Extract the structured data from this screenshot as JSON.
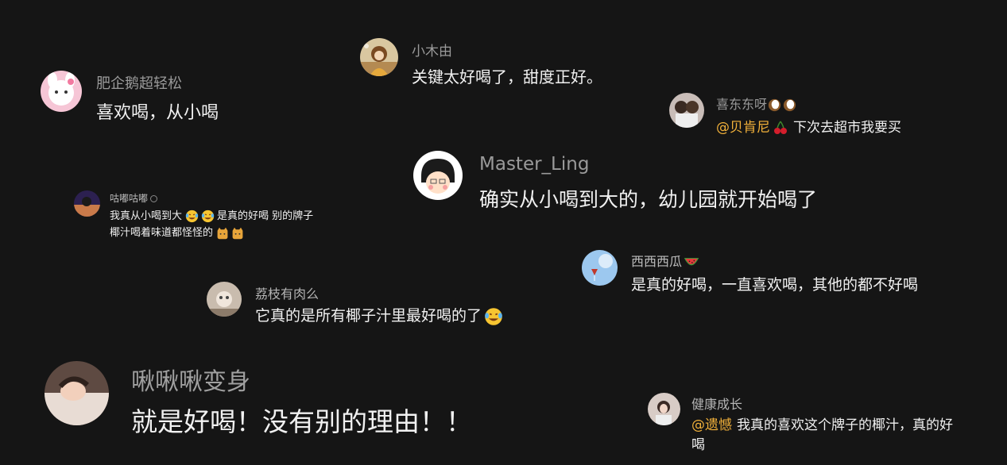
{
  "comments": [
    {
      "id": "xiaomuyou",
      "username": "小木由",
      "text": "关键太好喝了，甜度正好。"
    },
    {
      "id": "feiqie",
      "username": "肥企鹅超轻松",
      "text": "喜欢喝，从小喝"
    },
    {
      "id": "xidong",
      "username": "喜东东呀",
      "username_emojis": [
        "coconut",
        "coconut"
      ],
      "mention": "@贝肯尼",
      "mention_emoji": "cherries",
      "text": "下次去超市我要买"
    },
    {
      "id": "masterling",
      "username": "Master_Ling",
      "text": "确实从小喝到大的，幼儿园就开始喝了"
    },
    {
      "id": "gudu",
      "username": "咕嘟咕嘟",
      "badge": "verified-badge",
      "text_line1_a": "我真从小喝到大",
      "text_line1_emojis": [
        "laughing-tears",
        "laughing-tears"
      ],
      "text_line1_b": "是真的好喝 别的牌子",
      "text_line2": "椰汁喝着味道都怪怪的",
      "text_line2_emojis": [
        "cat-face",
        "cat-face"
      ]
    },
    {
      "id": "xigua",
      "username": "西西西瓜",
      "username_emoji": "watermelon",
      "text": "是真的好喝，一直喜欢喝，其他的都不好喝"
    },
    {
      "id": "lizhi",
      "username": "荔枝有肉么",
      "text": "它真的是所有椰子汁里最好喝的了",
      "text_emoji": "laughing-tears"
    },
    {
      "id": "jiujiu",
      "username": "啾啾啾变身",
      "text": "就是好喝！没有别的理由！！"
    },
    {
      "id": "jiankang",
      "username": "健康成长",
      "mention": "@遗憾",
      "text_line1": "我真的喜欢这个牌子的椰汁，真的好",
      "text_line2": "喝"
    }
  ],
  "colors": {
    "background": "#151515",
    "username": "#9a9a9a",
    "text": "#f1f1f1",
    "mention": "#f2b13a"
  }
}
